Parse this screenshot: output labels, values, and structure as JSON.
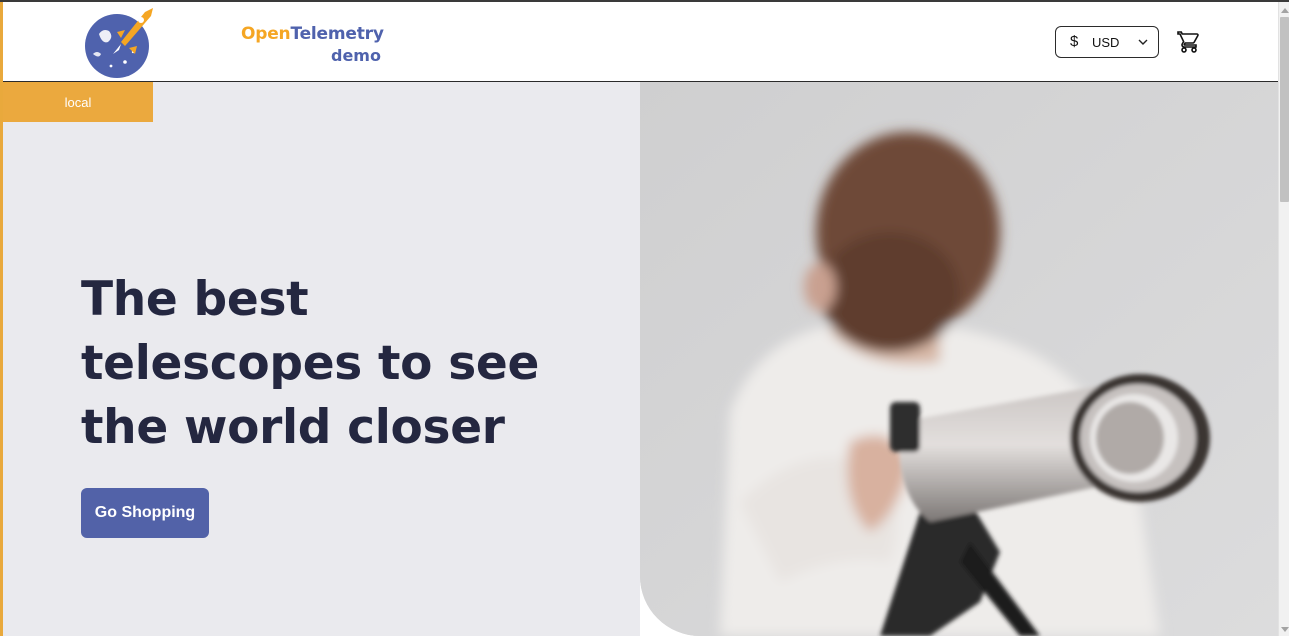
{
  "header": {
    "logo": {
      "alt_name": "OpenTelemetry demo",
      "text_open": "Open",
      "text_telemetry": "Telemetry",
      "text_demo": "demo"
    },
    "currency": {
      "symbol": "$",
      "selected": "USD"
    },
    "cart_icon": "cart-icon"
  },
  "environment_badge": "local",
  "hero": {
    "title": "The best telescopes to see the world closer",
    "cta_label": "Go Shopping"
  },
  "colors": {
    "brand_orange": "#eba93e",
    "brand_blue": "#5262a8",
    "title_text": "#242740",
    "hero_bg": "#eaeaee"
  }
}
